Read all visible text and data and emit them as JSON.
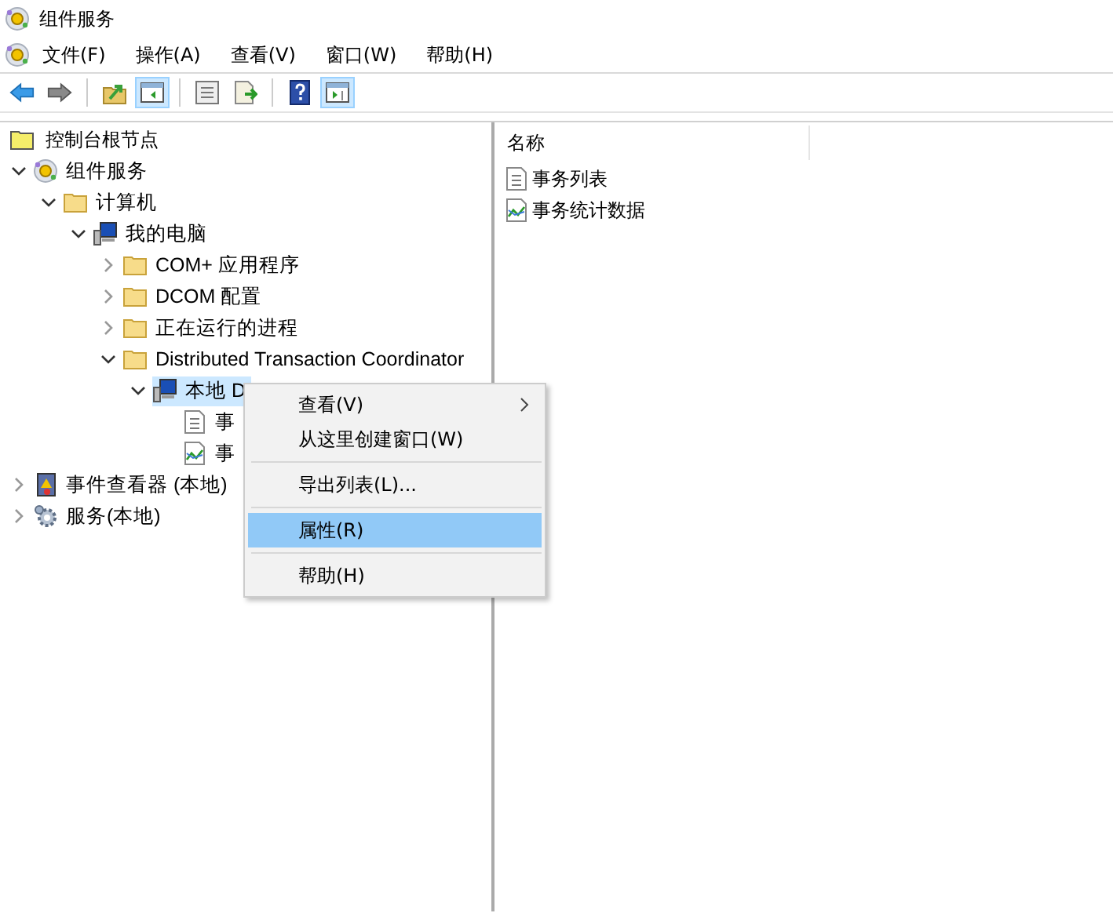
{
  "window": {
    "title": "组件服务"
  },
  "menu_bar": [
    "文件(F)",
    "操作(A)",
    "查看(V)",
    "窗口(W)",
    "帮助(H)"
  ],
  "toolbar": [
    {
      "kind": "back",
      "pressed": false
    },
    {
      "kind": "forward",
      "pressed": false
    },
    {
      "kind": "separator"
    },
    {
      "kind": "up",
      "pressed": false
    },
    {
      "kind": "tree-toggle",
      "pressed": true
    },
    {
      "kind": "separator"
    },
    {
      "kind": "properties",
      "pressed": false
    },
    {
      "kind": "export",
      "pressed": false
    },
    {
      "kind": "separator"
    },
    {
      "kind": "help",
      "pressed": false
    },
    {
      "kind": "action-pane",
      "pressed": true
    }
  ],
  "console_root": {
    "label": "控制台根节点"
  },
  "tree": [
    {
      "label": "组件服务",
      "kind": "component",
      "expanded": true,
      "selected": false,
      "children": [
        {
          "label": "计算机",
          "kind": "folder",
          "expanded": true,
          "selected": false,
          "children": [
            {
              "label": "我的电脑",
              "kind": "computer",
              "expanded": true,
              "selected": false,
              "children": [
                {
                  "label": "COM+ 应用程序",
                  "kind": "folder",
                  "expanded": false,
                  "selected": false
                },
                {
                  "label": "DCOM 配置",
                  "kind": "folder",
                  "expanded": false,
                  "selected": false
                },
                {
                  "label": "正在运行的进程",
                  "kind": "folder",
                  "expanded": false,
                  "selected": false
                },
                {
                  "label": "Distributed Transaction Coordinator",
                  "kind": "folder",
                  "expanded": true,
                  "selected": false,
                  "children": [
                    {
                      "label": "本地 D",
                      "kind": "computer",
                      "expanded": true,
                      "selected": true,
                      "children": [
                        {
                          "label": "事",
                          "kind": "list",
                          "selected": false
                        },
                        {
                          "label": "事",
                          "kind": "chart",
                          "selected": false
                        }
                      ]
                    }
                  ]
                }
              ]
            }
          ]
        }
      ]
    },
    {
      "label": "事件查看器 (本地)",
      "kind": "event-viewer",
      "expanded": false,
      "selected": false
    },
    {
      "label": "服务(本地)",
      "kind": "services",
      "expanded": false,
      "selected": false
    }
  ],
  "list": {
    "columns": [
      "名称"
    ],
    "items": [
      {
        "label": "事务列表",
        "kind": "list"
      },
      {
        "label": "事务统计数据",
        "kind": "chart"
      }
    ]
  },
  "context_menu": [
    {
      "kind": "item",
      "label": "查看(V)",
      "submenu": true,
      "selected": false
    },
    {
      "kind": "item",
      "label": "从这里创建窗口(W)",
      "submenu": false,
      "selected": false
    },
    {
      "kind": "separator"
    },
    {
      "kind": "item",
      "label": "导出列表(L)...",
      "submenu": false,
      "selected": false
    },
    {
      "kind": "separator"
    },
    {
      "kind": "item",
      "label": "属性(R)",
      "submenu": false,
      "selected": true
    },
    {
      "kind": "separator"
    },
    {
      "kind": "item",
      "label": "帮助(H)",
      "submenu": false,
      "selected": false
    }
  ]
}
